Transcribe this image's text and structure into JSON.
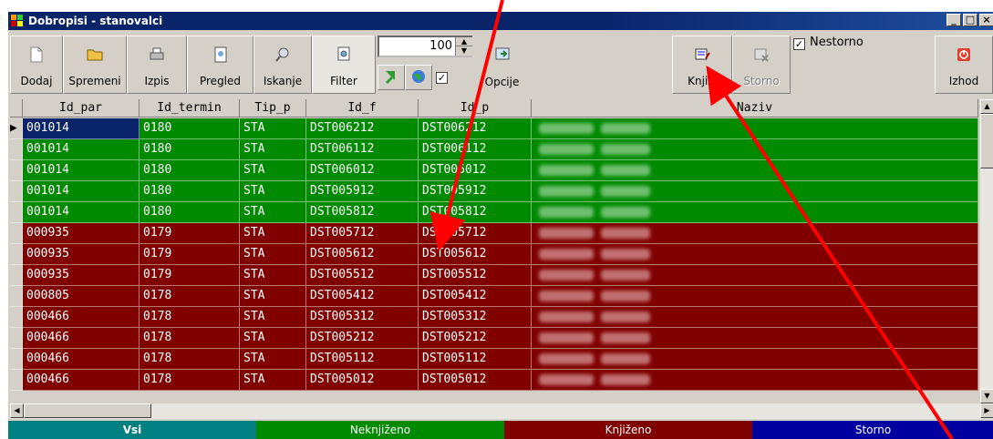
{
  "window": {
    "title": "Dobropisi - stanovalci"
  },
  "toolbar": {
    "dodaj": "Dodaj",
    "spremeni": "Spremeni",
    "izpis": "Izpis",
    "pregled": "Pregled",
    "iskanje": "Iskanje",
    "filter": "Filter",
    "spin_value": "100",
    "opcije": "Opcije",
    "knjizi": "Knjiži",
    "storno": "Storno",
    "nestorno": "Nestorno",
    "izhod": "Izhod"
  },
  "grid": {
    "headers": [
      "Id_par",
      "Id_termin",
      "Tip_p",
      "Id_f",
      "Id_p",
      "Naziv"
    ],
    "rows": [
      [
        "001014",
        "0180",
        "STA",
        "DST006212",
        "DST006212",
        "green"
      ],
      [
        "001014",
        "0180",
        "STA",
        "DST006112",
        "DST006112",
        "green"
      ],
      [
        "001014",
        "0180",
        "STA",
        "DST006012",
        "DST006012",
        "green"
      ],
      [
        "001014",
        "0180",
        "STA",
        "DST005912",
        "DST005912",
        "green"
      ],
      [
        "001014",
        "0180",
        "STA",
        "DST005812",
        "DST005812",
        "green"
      ],
      [
        "000935",
        "0179",
        "STA",
        "DST005712",
        "DST005712",
        "red"
      ],
      [
        "000935",
        "0179",
        "STA",
        "DST005612",
        "DST005612",
        "red"
      ],
      [
        "000935",
        "0179",
        "STA",
        "DST005512",
        "DST005512",
        "red"
      ],
      [
        "000805",
        "0178",
        "STA",
        "DST005412",
        "DST005412",
        "red"
      ],
      [
        "000466",
        "0178",
        "STA",
        "DST005312",
        "DST005312",
        "red"
      ],
      [
        "000466",
        "0178",
        "STA",
        "DST005212",
        "DST005212",
        "red"
      ],
      [
        "000466",
        "0178",
        "STA",
        "DST005112",
        "DST005112",
        "red"
      ],
      [
        "000466",
        "0178",
        "STA",
        "DST005012",
        "DST005012",
        "red"
      ]
    ]
  },
  "legend": {
    "vsi": "Vsi",
    "neknjizeno": "Neknjiženo",
    "knjizeno": "Knjiženo",
    "storno": "Storno"
  },
  "colors": {
    "booked_row": "#800000",
    "unbooked_row": "#008a00",
    "legend_vsi": "#008080",
    "legend_storno": "#0000a0",
    "annotation_arrow": "#ff0000"
  }
}
